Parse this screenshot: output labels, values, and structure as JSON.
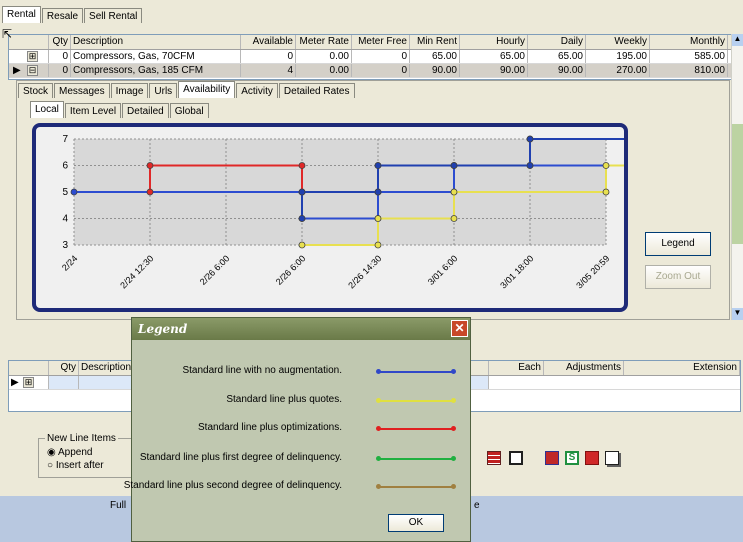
{
  "top_tabs": [
    "Rental",
    "Resale",
    "Sell Rental"
  ],
  "top_grid": {
    "headers": [
      "Qty",
      "Description",
      "Available",
      "Meter Rate",
      "Meter Free",
      "Min Rent",
      "Hourly",
      "Daily",
      "Weekly",
      "Monthly"
    ],
    "rows": [
      {
        "expander": "⊞",
        "qty": "0",
        "description": "Compressors, Gas, 70CFM",
        "available": "0",
        "meter_rate": "0.00",
        "meter_free": "0",
        "min_rent": "65.00",
        "hourly": "65.00",
        "daily": "65.00",
        "weekly": "195.00",
        "monthly": "585.00"
      },
      {
        "expander": "⊟",
        "qty": "0",
        "description": "Compressors, Gas, 185 CFM",
        "available": "4",
        "meter_rate": "0.00",
        "meter_free": "0",
        "min_rent": "90.00",
        "hourly": "90.00",
        "daily": "90.00",
        "weekly": "270.00",
        "monthly": "810.00"
      }
    ]
  },
  "detail_tabs": [
    "Stock",
    "Messages",
    "Image",
    "Urls",
    "Availability",
    "Activity",
    "Detailed Rates"
  ],
  "sub_tabs": [
    "Local",
    "Item Level",
    "Detailed",
    "Global"
  ],
  "chart_data": {
    "type": "line",
    "step": true,
    "ylim": [
      3,
      7
    ],
    "y_ticks": [
      "3",
      "4",
      "5",
      "6",
      "7"
    ],
    "x_ticks": [
      "2/24",
      "2/24 12:30",
      "2/26 6:00",
      "2/26 6:00",
      "2/26 14:30",
      "3/01 6:00",
      "3/01 18:00",
      "3/05 20:59"
    ],
    "series": [
      {
        "color": "#2c4cd0",
        "x": [
          0,
          3,
          3,
          4,
          4,
          5,
          5,
          8
        ],
        "values": [
          5,
          5,
          4,
          4,
          5,
          5,
          6,
          6
        ]
      },
      {
        "color": "#e8e050",
        "x": [
          3,
          4,
          4,
          5,
          5,
          7,
          7,
          8
        ],
        "values": [
          3,
          3,
          4,
          4,
          5,
          5,
          6,
          6
        ]
      },
      {
        "color": "#e02828",
        "x": [
          1,
          1,
          3,
          3,
          4,
          4,
          6,
          6,
          8
        ],
        "values": [
          5,
          6,
          6,
          5,
          5,
          6,
          6,
          7,
          7
        ]
      },
      {
        "color": "#2040b0",
        "x": [
          3,
          3,
          4,
          4,
          5,
          5,
          6,
          6,
          8
        ],
        "values": [
          4,
          5,
          5,
          6,
          6,
          6,
          6,
          7,
          7
        ]
      }
    ]
  },
  "buttons": {
    "legend": "Legend",
    "zoom_out": "Zoom Out",
    "ok": "OK"
  },
  "bottom_grid": {
    "headers": [
      "Qty",
      "Description",
      "Each",
      "Adjustments",
      "Extension"
    ]
  },
  "new_line_items": {
    "title": "New Line Items",
    "options": [
      "Append",
      "Insert after"
    ],
    "selected": "Append"
  },
  "status_fragment_left": "Full",
  "status_fragment_right": "e",
  "legend_dialog": {
    "title": "Legend",
    "entries": [
      {
        "label": "Standard line with no augmentation.",
        "color": "#3048c8"
      },
      {
        "label": "Standard line plus quotes.",
        "color": "#e0e040"
      },
      {
        "label": "Standard line plus optimizations.",
        "color": "#e02020"
      },
      {
        "label": "Standard line plus first degree of delinquency.",
        "color": "#20b040"
      },
      {
        "label": "Standard line plus second degree of delinquency.",
        "color": "#a08040"
      }
    ]
  }
}
